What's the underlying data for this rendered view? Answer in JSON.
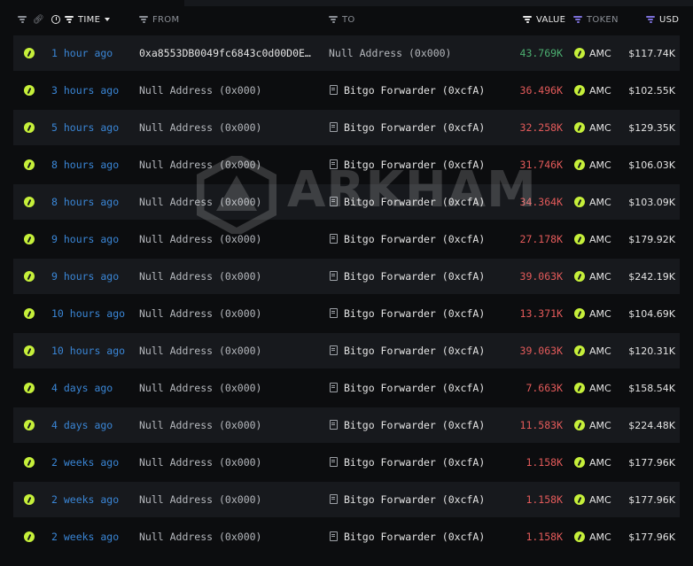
{
  "header": {
    "time_label": "TIME",
    "from_label": "FROM",
    "to_label": "TO",
    "value_label": "VALUE",
    "token_label": "TOKEN",
    "usd_label": "USD"
  },
  "watermark": "ARKHAM",
  "colors": {
    "background": "#0c0d0f",
    "row_alt": "#17191d",
    "time_link": "#3a86d6",
    "value_positive": "#4caf70",
    "value_negative": "#e35a5a",
    "token_accent": "#c6f03a",
    "filter_purple": "#7b6fd8"
  },
  "rows": [
    {
      "time": "1 hour ago",
      "from": "0xa8553DB0049fc6843c0d00D0E…",
      "to": "Null Address (0x000)",
      "value": "43.769K",
      "token": "AMC",
      "usd": "$117.74K",
      "value_sign": "pos"
    },
    {
      "time": "3 hours ago",
      "from": "Null Address (0x000)",
      "to": "Bitgo Forwarder (0xcfA)",
      "value": "36.496K",
      "token": "AMC",
      "usd": "$102.55K",
      "value_sign": "neg"
    },
    {
      "time": "5 hours ago",
      "from": "Null Address (0x000)",
      "to": "Bitgo Forwarder (0xcfA)",
      "value": "32.258K",
      "token": "AMC",
      "usd": "$129.35K",
      "value_sign": "neg"
    },
    {
      "time": "8 hours ago",
      "from": "Null Address (0x000)",
      "to": "Bitgo Forwarder (0xcfA)",
      "value": "31.746K",
      "token": "AMC",
      "usd": "$106.03K",
      "value_sign": "neg"
    },
    {
      "time": "8 hours ago",
      "from": "Null Address (0x000)",
      "to": "Bitgo Forwarder (0xcfA)",
      "value": "34.364K",
      "token": "AMC",
      "usd": "$103.09K",
      "value_sign": "neg"
    },
    {
      "time": "9 hours ago",
      "from": "Null Address (0x000)",
      "to": "Bitgo Forwarder (0xcfA)",
      "value": "27.178K",
      "token": "AMC",
      "usd": "$179.92K",
      "value_sign": "neg"
    },
    {
      "time": "9 hours ago",
      "from": "Null Address (0x000)",
      "to": "Bitgo Forwarder (0xcfA)",
      "value": "39.063K",
      "token": "AMC",
      "usd": "$242.19K",
      "value_sign": "neg"
    },
    {
      "time": "10 hours ago",
      "from": "Null Address (0x000)",
      "to": "Bitgo Forwarder (0xcfA)",
      "value": "13.371K",
      "token": "AMC",
      "usd": "$104.69K",
      "value_sign": "neg"
    },
    {
      "time": "10 hours ago",
      "from": "Null Address (0x000)",
      "to": "Bitgo Forwarder (0xcfA)",
      "value": "39.063K",
      "token": "AMC",
      "usd": "$120.31K",
      "value_sign": "neg"
    },
    {
      "time": "4 days ago",
      "from": "Null Address (0x000)",
      "to": "Bitgo Forwarder (0xcfA)",
      "value": "7.663K",
      "token": "AMC",
      "usd": "$158.54K",
      "value_sign": "neg"
    },
    {
      "time": "4 days ago",
      "from": "Null Address (0x000)",
      "to": "Bitgo Forwarder (0xcfA)",
      "value": "11.583K",
      "token": "AMC",
      "usd": "$224.48K",
      "value_sign": "neg"
    },
    {
      "time": "2 weeks ago",
      "from": "Null Address (0x000)",
      "to": "Bitgo Forwarder (0xcfA)",
      "value": "1.158K",
      "token": "AMC",
      "usd": "$177.96K",
      "value_sign": "neg"
    },
    {
      "time": "2 weeks ago",
      "from": "Null Address (0x000)",
      "to": "Bitgo Forwarder (0xcfA)",
      "value": "1.158K",
      "token": "AMC",
      "usd": "$177.96K",
      "value_sign": "neg"
    },
    {
      "time": "2 weeks ago",
      "from": "Null Address (0x000)",
      "to": "Bitgo Forwarder (0xcfA)",
      "value": "1.158K",
      "token": "AMC",
      "usd": "$177.96K",
      "value_sign": "neg"
    }
  ]
}
